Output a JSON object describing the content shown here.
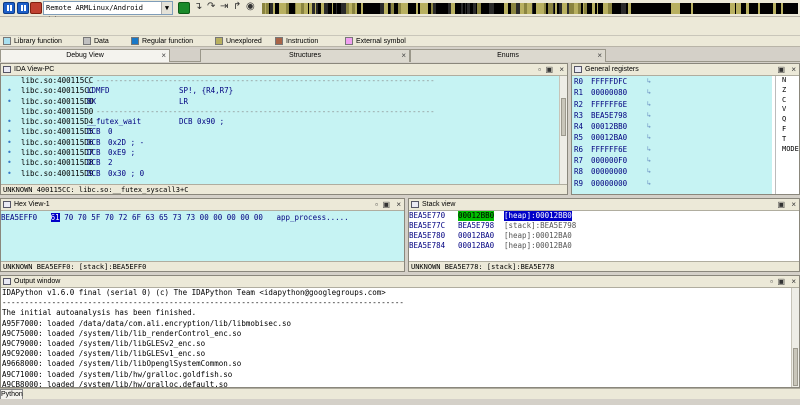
{
  "toolbar": {
    "debugger_name": "Remote ARMLinux/Android debugger",
    "navbar_colors": [
      "#000000",
      "#b8b060",
      "#2a2a2a",
      "#8a8440",
      "#000000",
      "#b8b060",
      "#000000"
    ]
  },
  "legend": [
    {
      "label": "Library function",
      "color": "#a8e0f0"
    },
    {
      "label": "Data",
      "color": "#c0c0c0"
    },
    {
      "label": "Regular function",
      "color": "#1878c8"
    },
    {
      "label": "Unexplored",
      "color": "#b8b060"
    },
    {
      "label": "Instruction",
      "color": "#a86448"
    },
    {
      "label": "External symbol",
      "color": "#f0a0f0"
    }
  ],
  "tabs": [
    {
      "label": "Debug View",
      "active": true
    },
    {
      "label": "Structures",
      "active": false
    },
    {
      "label": "Enums",
      "active": false
    }
  ],
  "ida_view": {
    "title": "IDA View-PC",
    "lines": [
      {
        "dot": "",
        "addr": "libc.so:400115CC",
        "mnemonic": "",
        "operands": "; ---------------------------------------------------------------------------",
        "type": "sep"
      },
      {
        "dot": "•",
        "addr": "libc.so:400115CC",
        "mnemonic": "LDMFD",
        "operands": "SP!, {R4,R7}",
        "type": "code"
      },
      {
        "dot": "•",
        "addr": "libc.so:400115D0",
        "mnemonic": "BX",
        "operands": "LR",
        "type": "code"
      },
      {
        "dot": "",
        "addr": "libc.so:400115D0",
        "mnemonic": "",
        "operands": "; ---------------------------------------------------------------------------",
        "type": "sep"
      },
      {
        "dot": "•",
        "addr": "libc.so:400115D4",
        "mnemonic": "__futex_wait",
        "operands": "DCB 0x90 ;",
        "type": "db2"
      },
      {
        "dot": "•",
        "addr": "libc.so:400115D5",
        "mnemonic": "DCB",
        "operands": "0",
        "type": "db"
      },
      {
        "dot": "•",
        "addr": "libc.so:400115D6",
        "mnemonic": "DCB",
        "operands": "0x2D ; -",
        "type": "db"
      },
      {
        "dot": "•",
        "addr": "libc.so:400115D7",
        "mnemonic": "DCB",
        "operands": "0xE9 ;",
        "type": "db"
      },
      {
        "dot": "•",
        "addr": "libc.so:400115D8",
        "mnemonic": "DCB",
        "operands": "2",
        "type": "db"
      },
      {
        "dot": "•",
        "addr": "libc.so:400115D9",
        "mnemonic": "DCB",
        "operands": "0x30 ; 0",
        "type": "db"
      }
    ],
    "status": "UNKNOWN 400115CC: libc.so:__futex_syscall3+C"
  },
  "registers": {
    "title": "General registers",
    "rows": [
      {
        "name": "R0",
        "value": "FFFFFDFC"
      },
      {
        "name": "R1",
        "value": "00000080"
      },
      {
        "name": "R2",
        "value": "FFFFFF6E"
      },
      {
        "name": "R3",
        "value": "BEA5E798"
      },
      {
        "name": "R4",
        "value": "00012BB0"
      },
      {
        "name": "R5",
        "value": "00012BA0"
      },
      {
        "name": "R6",
        "value": "FFFFFF6E"
      },
      {
        "name": "R7",
        "value": "000000F0"
      },
      {
        "name": "R8",
        "value": "00000000"
      },
      {
        "name": "R9",
        "value": "00000000"
      }
    ],
    "flags": [
      "N",
      "Z",
      "C",
      "V",
      "Q",
      "F",
      "T",
      "MODE"
    ]
  },
  "hex_view": {
    "title": "Hex View-1",
    "address": "BEA5EFF0",
    "selected_byte": "61",
    "bytes": "70 70 5F 70 72 6F 63  65 73 73 00 00 00 00 00",
    "ascii": "app_process.....",
    "status": "UNKNOWN BEA5EFF0: [stack]:BEA5EFF0"
  },
  "stack_view": {
    "title": "Stack view",
    "rows": [
      {
        "addr": "BEA5E770",
        "value": "00012BB0",
        "desc": "[heap]:00012BB0",
        "current": true
      },
      {
        "addr": "BEA5E77C",
        "value": "BEA5E798",
        "desc": "[stack]:BEA5E798",
        "current": false
      },
      {
        "addr": "BEA5E780",
        "value": "00012BA0",
        "desc": "[heap]:00012BA0",
        "current": false
      },
      {
        "addr": "BEA5E784",
        "value": "00012BA0",
        "desc": "[heap]:00012BA0",
        "current": false
      }
    ],
    "status": "UNKNOWN BEA5E778: [stack]:BEA5E778"
  },
  "output": {
    "title": "Output window",
    "lines": [
      "IDAPython v1.6.0 final (serial 0) (c) The IDAPython Team <idapython@googlegroups.com>",
      "-----------------------------------------------------------------------------------------",
      "The initial autoanalysis has been finished.",
      "A95F7000: loaded /data/data/com.ali.encryption/lib/libmobisec.so",
      "A9C75000: loaded /system/lib/lib_renderControl_enc.so",
      "A9C79000: loaded /system/lib/libGLESv2_enc.so",
      "A9C92000: loaded /system/lib/libGLESv1_enc.so",
      "A9668000: loaded /system/lib/libOpenglSystemCommon.so",
      "A9C71000: loaded /system/lib/hw/gralloc.goldfish.so",
      "A9CB8000: loaded /system/lib/hw/gralloc.default.so"
    ],
    "python_button": "Python"
  }
}
